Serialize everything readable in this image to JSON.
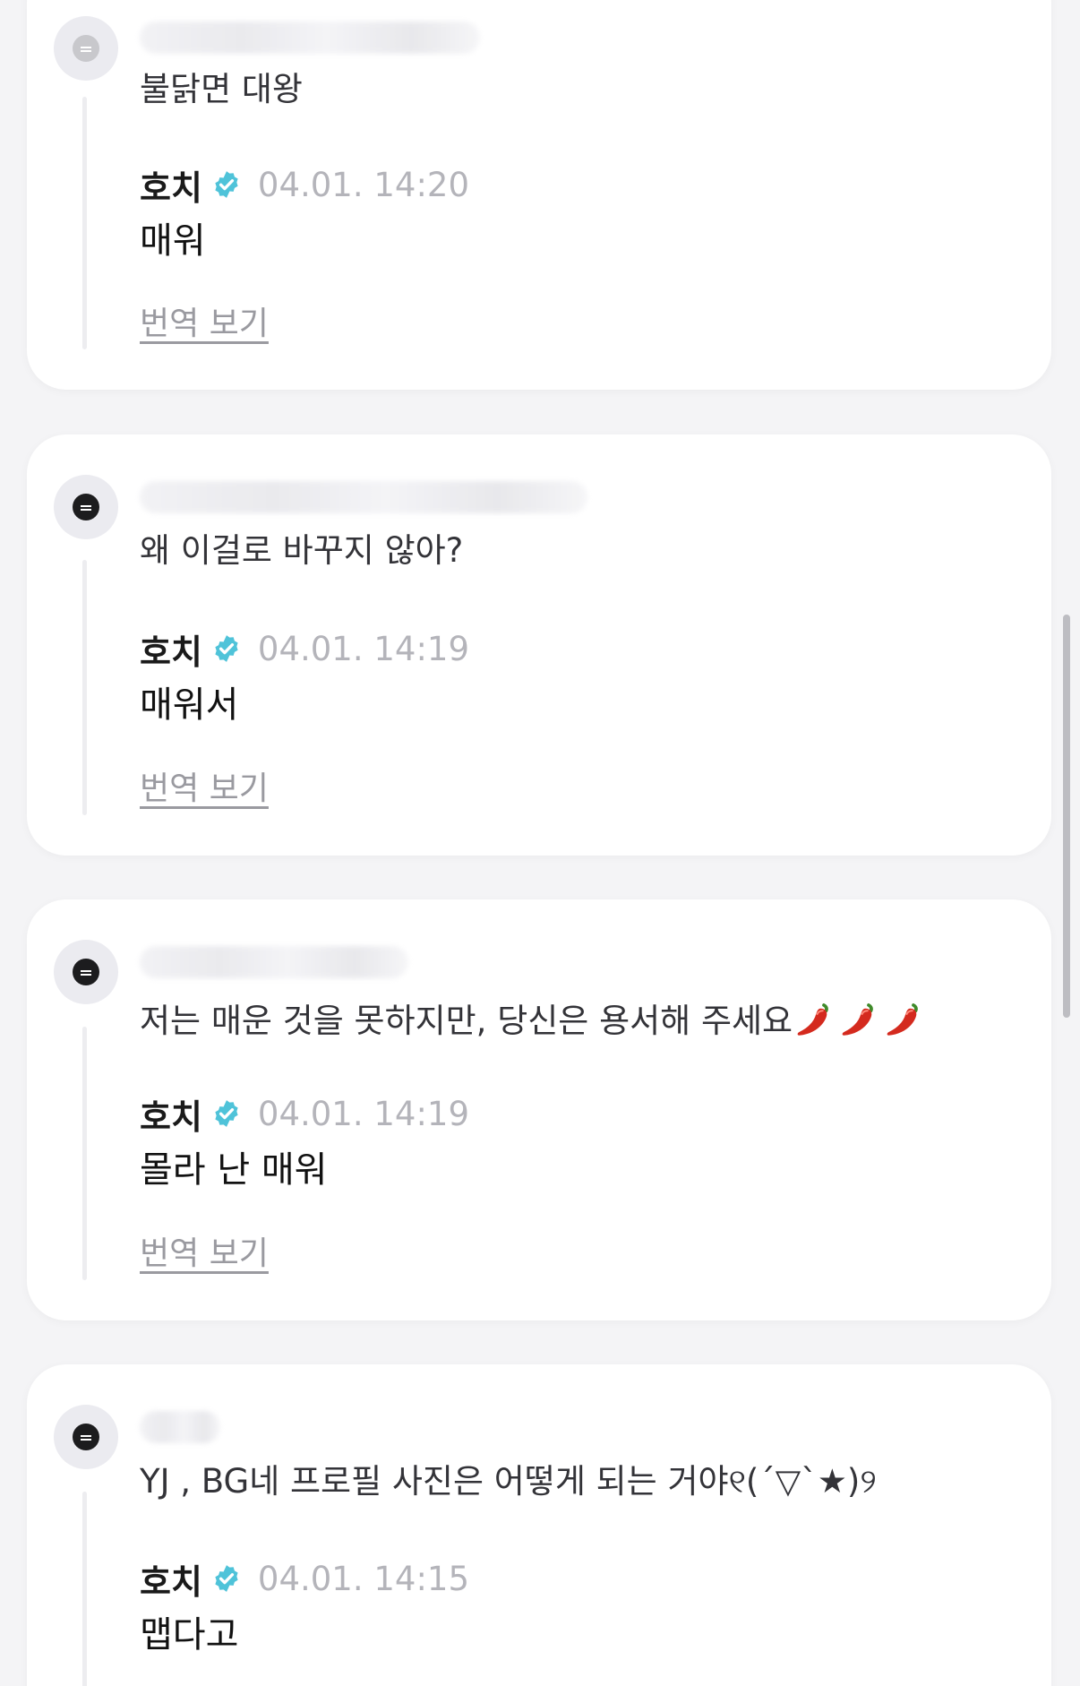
{
  "comments": [
    {
      "text": "불닭면 대왕",
      "reply": {
        "author": "호치",
        "time": "04.01. 14:20",
        "text": "매워",
        "translate_label": "번역 보기"
      }
    },
    {
      "text": "왜 이걸로 바꾸지 않아?",
      "reply": {
        "author": "호치",
        "time": "04.01. 14:19",
        "text": "매워서",
        "translate_label": "번역 보기"
      }
    },
    {
      "text": "저는 매운 것을 못하지만, 당신은 용서해 주세요",
      "reply": {
        "author": "호치",
        "time": "04.01. 14:19",
        "text": "몰라 난 매워",
        "translate_label": "번역 보기"
      }
    },
    {
      "text": "YJ , BG네 프로필 사진은 어떻게 되는 거야୧(´▽`★)୨",
      "reply": {
        "author": "호치",
        "time": "04.01. 14:15",
        "text": "맵다고"
      }
    }
  ],
  "icons": {
    "verified": "verified-badge-icon",
    "pepper": "chili-pepper-icon",
    "avatar": "default-avatar-icon"
  },
  "colors": {
    "verified_badge": "#4fc3d9",
    "pepper": "#d42a1e",
    "time_text": "#b4b4ba",
    "link_text": "#9a9aa0"
  }
}
